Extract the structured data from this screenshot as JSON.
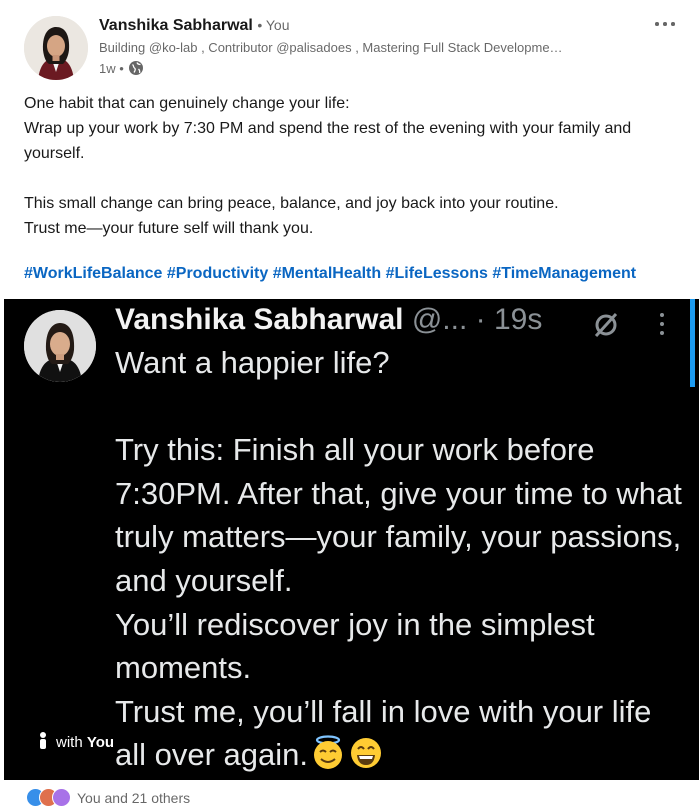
{
  "post": {
    "author_name": "Vanshika Sabharwal",
    "author_tag": "• You",
    "headline": "Building @ko-lab , Contributor @palisadoes , Mastering Full Stack Developme…",
    "age": "1w •",
    "more_icon": "more-horizontal-icon",
    "visibility_icon": "globe-icon",
    "text_lines": [
      "One habit that can genuinely change your life:",
      "Wrap up your work by 7:30 PM and spend the rest of the evening with your family and yourself.",
      "This small change can bring peace, balance, and joy back into your routine.",
      "Trust me—your future self will thank you."
    ],
    "hashtags": [
      "#WorkLifeBalance",
      "#Productivity",
      "#MentalHealth",
      "#LifeLessons",
      "#TimeManagement"
    ]
  },
  "image": {
    "tweet_name": "Vanshika Sabharwal",
    "tweet_handle": "@...",
    "tweet_dot": "·",
    "tweet_time": "19s",
    "tweet_lines": [
      "Want a happier life?",
      "Try this: Finish all your work before 7:30PM. After that, give your time to what truly matters—your family, your passions, and yourself.",
      "You’ll rediscover joy in the simplest moments.",
      "Trust me, you’ll fall in love with your life all over again."
    ],
    "tag_prefix": "with",
    "tag_name": "You",
    "accent": "#1d9bf0"
  },
  "reactions": {
    "summary": "You and 21 others",
    "icons": [
      "like-icon",
      "love-icon",
      "support-icon"
    ]
  },
  "colors": {
    "link": "#0a66c2",
    "text": "#191919",
    "muted": "#666666"
  }
}
